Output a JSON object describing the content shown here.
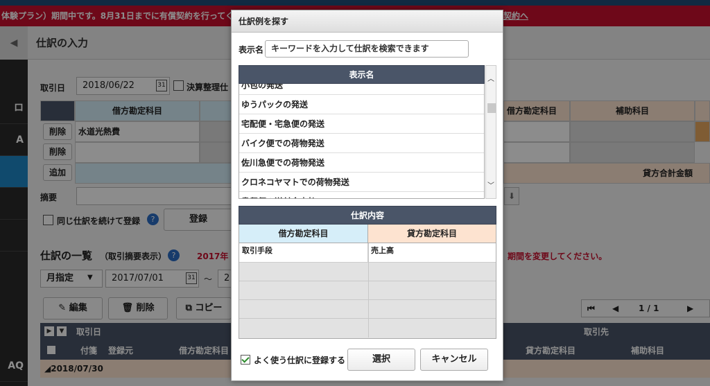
{
  "banner": {
    "text": "体験プラン）期間中です。8月31日までに有償契約を行ってく",
    "link": "契約へ"
  },
  "sidebar": {
    "items": [
      "ロ",
      "A",
      "",
      "",
      "",
      "",
      "AQ"
    ]
  },
  "page": {
    "title": "仕訳の入力"
  },
  "form": {
    "date_label": "取引日",
    "date_value": "2018/06/22",
    "closing_label": "決算整理仕",
    "header_debit": "借方勘定科目",
    "header_sub": "補助科目",
    "header_credit": "借方勘定科目",
    "rows": [
      {
        "button": "削除",
        "debit": "水道光熱費"
      },
      {
        "button": "削除",
        "debit": ""
      }
    ],
    "add_button": "追加",
    "credit_total_label": "貸方合計金額",
    "memo_label": "摘要",
    "continue_label": "同じ仕訳を続けて登録",
    "register_button": "登録"
  },
  "list": {
    "title": "仕訳の一覧",
    "subtitle": "（取引摘要表示）",
    "warning_left": "2017年",
    "warning_right": "期間を変更してください。",
    "period_select": "月指定",
    "from_date": "2017/07/01",
    "tilde": "～",
    "to_date_partial": "2",
    "edit_button": "編集",
    "delete_button": "削除",
    "copy_button": "コピー",
    "pagination": "1 / 1",
    "col_date": "取引日",
    "col_partner": "取引先",
    "col_tag": "付箋",
    "col_source": "登録元",
    "col_debit": "借方勘定科目",
    "col_credit": "貸方勘定科目",
    "col_sub": "補助科目",
    "group_date": "2018/07/30"
  },
  "modal": {
    "title": "仕訳例を探す",
    "search_label": "表示名",
    "search_placeholder": "キーワードを入力して仕訳を検索できます",
    "list_header": "表示名",
    "items": [
      "小包の発送",
      "ゆうパックの発送",
      "宅配便・宅急便の発送",
      "バイク便での荷物発送",
      "佐川急便での荷物発送",
      "クロネコヤマトでの荷物発送",
      "書留便の送付金支払い"
    ],
    "detail_header": "仕訳内容",
    "detail_debit_header": "借方勘定科目",
    "detail_credit_header": "貸方勘定科目",
    "detail_debit_value": "取引手段",
    "detail_credit_value": "売上高",
    "favorite_label": "よく使う仕訳に登録する",
    "select_button": "選択",
    "cancel_button": "キャンセル"
  }
}
